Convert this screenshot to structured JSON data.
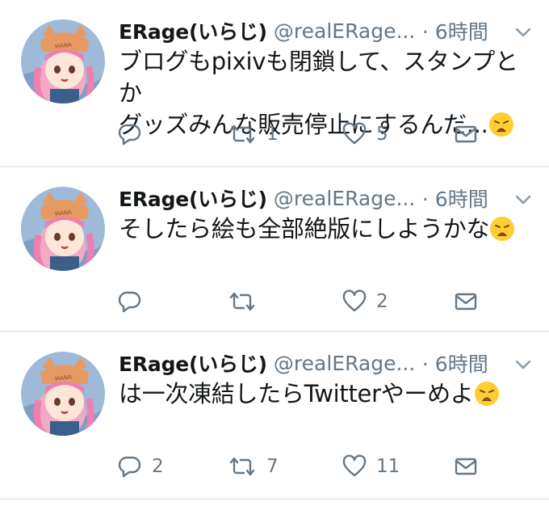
{
  "tweets": [
    {
      "name": "ERage(いらじ)",
      "handle": "@realERage...",
      "time": "· 6時間",
      "lines": [
        "ブログもpixivも閉鎖して、スタンプとか",
        "グッズみんな販売停止にするんだ..."
      ],
      "emoji": "weary-face-emoji",
      "reply_count": "",
      "retweet_count": "1",
      "like_count": "5"
    },
    {
      "name": "ERage(いらじ)",
      "handle": "@realERage...",
      "time": "· 6時間",
      "lines": [
        "そしたら絵も全部絶版にしようかな"
      ],
      "emoji": "weary-face-emoji",
      "reply_count": "",
      "retweet_count": "",
      "like_count": "2"
    },
    {
      "name": "ERage(いらじ)",
      "handle": "@realERage...",
      "time": "· 6時間",
      "lines": [
        "は一次凍結したらTwitterやーめよ"
      ],
      "emoji": "weary-face-emoji",
      "reply_count": "2",
      "retweet_count": "7",
      "like_count": "11"
    }
  ],
  "colors": {
    "text": "#14171a",
    "secondary": "#657786",
    "divider": "#e6ecf0"
  },
  "icons": [
    "reply-icon",
    "retweet-icon",
    "like-icon",
    "direct-message-icon",
    "chevron-down-icon"
  ]
}
